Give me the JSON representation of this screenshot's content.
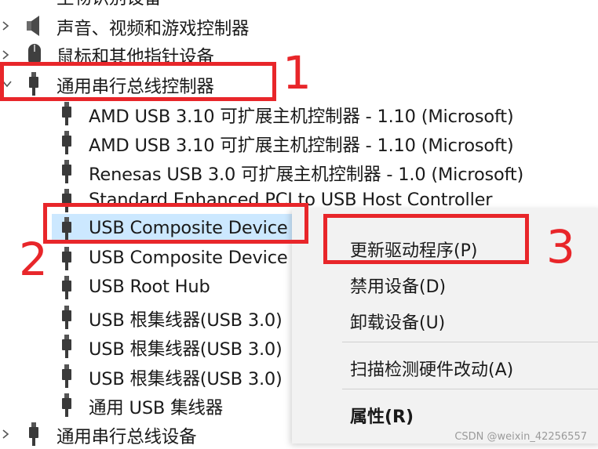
{
  "tree": {
    "partial_top": "生物识别设备",
    "items": [
      {
        "label": "声音、视频和游戏控制器",
        "level": 0,
        "expanded": false,
        "icon": "speaker-icon"
      },
      {
        "label": "鼠标和其他指针设备",
        "level": 0,
        "expanded": false,
        "icon": "mouse-icon"
      },
      {
        "label": "通用串行总线控制器",
        "level": 0,
        "expanded": true,
        "icon": "usb-icon"
      },
      {
        "label": "AMD USB 3.10 可扩展主机控制器 - 1.10 (Microsoft)",
        "level": 1,
        "icon": "usb-icon"
      },
      {
        "label": "AMD USB 3.10 可扩展主机控制器 - 1.10 (Microsoft)",
        "level": 1,
        "icon": "usb-icon"
      },
      {
        "label": "Renesas USB 3.0 可扩展主机控制器 - 1.0 (Microsoft)",
        "level": 1,
        "icon": "usb-icon"
      },
      {
        "label": "Standard Enhanced PCI to USB Host Controller",
        "level": 1,
        "icon": "usb-icon"
      },
      {
        "label": "USB Composite Device",
        "level": 1,
        "selected": true,
        "icon": "usb-icon"
      },
      {
        "label": "USB Composite Device",
        "level": 1,
        "icon": "usb-icon"
      },
      {
        "label": "USB Root Hub",
        "level": 1,
        "icon": "usb-icon"
      },
      {
        "label": "USB 根集线器(USB 3.0)",
        "level": 1,
        "icon": "usb-icon"
      },
      {
        "label": "USB 根集线器(USB 3.0)",
        "level": 1,
        "icon": "usb-icon"
      },
      {
        "label": "USB 根集线器(USB 3.0)",
        "level": 1,
        "icon": "usb-icon"
      },
      {
        "label": "通用 USB 集线器",
        "level": 1,
        "icon": "usb-icon"
      },
      {
        "label": "通用串行总线设备",
        "level": 0,
        "expanded": false,
        "icon": "usb-icon"
      }
    ]
  },
  "context_menu": {
    "items": [
      {
        "label": "更新驱动程序(P)",
        "bold": false
      },
      {
        "label": "禁用设备(D)",
        "bold": false
      },
      {
        "label": "卸载设备(U)",
        "bold": false
      },
      {
        "label": "扫描检测硬件改动(A)",
        "bold": false
      },
      {
        "label": "属性(R)",
        "bold": true
      }
    ]
  },
  "annotations": {
    "step1": "1",
    "step2": "2",
    "step3": "3"
  },
  "watermark": "CSDN @weixin_42256557",
  "colors": {
    "annotation_red": "#e8262a",
    "selection_bg": "#cce8ff",
    "menu_bg": "#f2f2f2",
    "text": "#1a1a1a"
  }
}
